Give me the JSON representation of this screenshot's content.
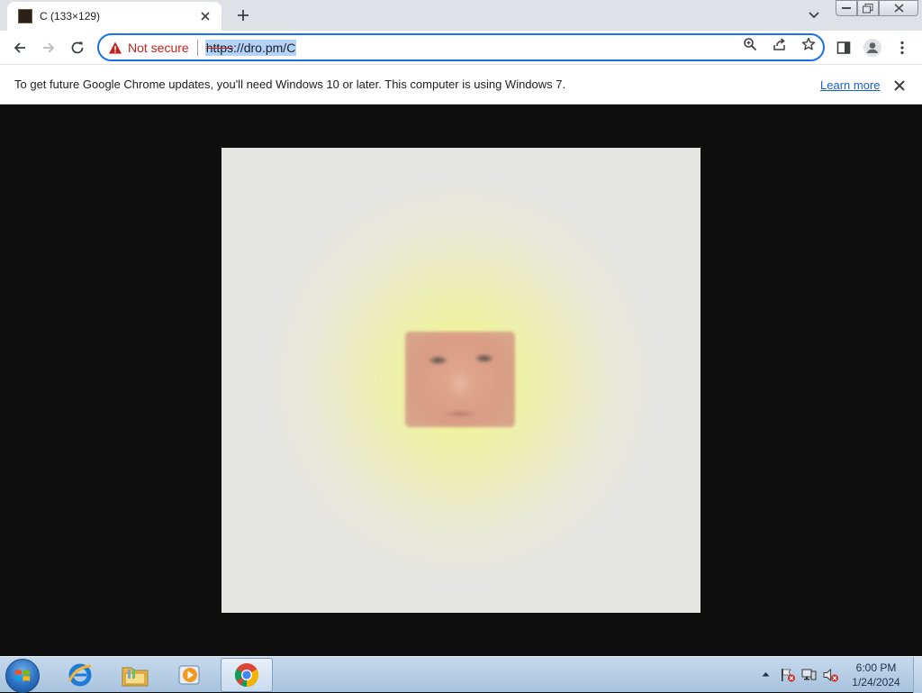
{
  "browser": {
    "tab": {
      "title": "C (133×129)"
    },
    "omnibox": {
      "security_label": "Not secure",
      "url_scheme": "https",
      "url_rest": "://dro.pm/C"
    }
  },
  "infobar": {
    "message": "To get future Google Chrome updates, you'll need Windows 10 or later. This computer is using Windows 7.",
    "link_label": "Learn more"
  },
  "taskbar": {
    "apps": [
      "internet-explorer-icon",
      "windows-explorer-icon",
      "media-player-icon",
      "chrome-icon"
    ],
    "clock": {
      "time": "6:00 PM",
      "date": "1/24/2024"
    }
  },
  "colors": {
    "accent": "#1a73e8",
    "warning": "#c5221f",
    "link": "#1a5fd0"
  }
}
